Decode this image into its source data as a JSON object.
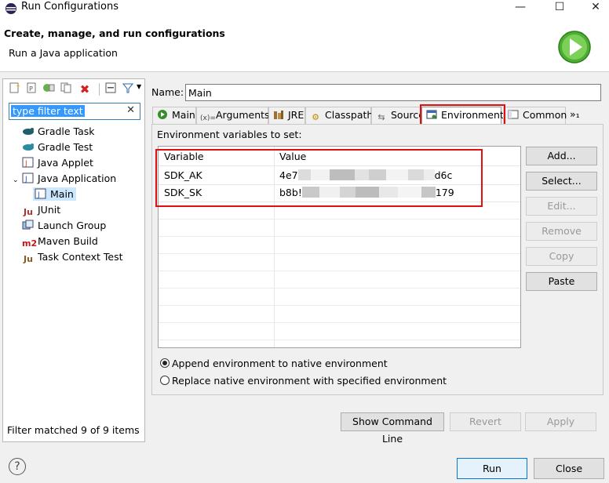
{
  "window": {
    "title": "Run Configurations",
    "minimize": "—",
    "maximize": "☐",
    "close": "✕"
  },
  "header": {
    "title": "Create, manage, and run configurations",
    "subtitle": "Run a Java application"
  },
  "left": {
    "filter": {
      "value": "type filter text"
    },
    "tree": [
      {
        "label": "Gradle Task"
      },
      {
        "label": "Gradle Test"
      },
      {
        "label": "Java Applet"
      },
      {
        "label": "Java Application"
      },
      {
        "label": "Main"
      },
      {
        "label": "JUnit"
      },
      {
        "label": "Launch Group"
      },
      {
        "label": "Maven Build"
      },
      {
        "label": "Task Context Test"
      }
    ],
    "status": "Filter matched 9 of 9 items"
  },
  "name": {
    "label": "Name:",
    "value": "Main"
  },
  "tabs": [
    {
      "label": "Main"
    },
    {
      "label": "Arguments"
    },
    {
      "label": "JRE"
    },
    {
      "label": "Classpath"
    },
    {
      "label": "Source"
    },
    {
      "label": "Environment"
    },
    {
      "label": "Common"
    },
    {
      "label": "»₁"
    }
  ],
  "env": {
    "heading": "Environment variables to set:",
    "columns": [
      "Variable",
      "Value"
    ],
    "rows": [
      {
        "variable": "SDK_AK",
        "value_start": "4e7",
        "value_end": "d6c"
      },
      {
        "variable": "SDK_SK",
        "value_start": "b8b!",
        "value_end": "179"
      }
    ],
    "buttons": {
      "add": "Add...",
      "select": "Select...",
      "edit": "Edit...",
      "remove": "Remove",
      "copy": "Copy",
      "paste": "Paste"
    },
    "options": [
      {
        "label": "Append environment to native environment",
        "selected": true
      },
      {
        "label": "Replace native environment with specified environment",
        "selected": false
      }
    ]
  },
  "actions": {
    "show_cmd": "Show Command Line",
    "revert": "Revert",
    "apply": "Apply",
    "run": "Run",
    "close": "Close"
  },
  "help": "?",
  "colors": {
    "highlight": "#e01010",
    "selection": "#3399ff",
    "run_icon": "#4caf30"
  }
}
